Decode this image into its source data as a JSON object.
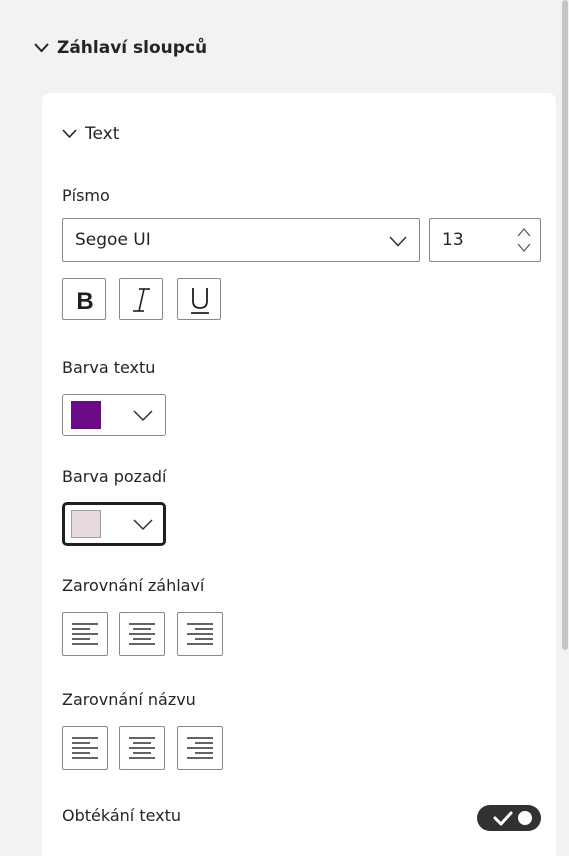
{
  "section": {
    "title": "Záhlaví sloupců"
  },
  "text_group": {
    "title": "Text",
    "font": {
      "label": "Písmo",
      "family": "Segoe UI",
      "size": "13"
    },
    "text_color": {
      "label": "Barva textu",
      "color": "#6b0a85"
    },
    "background_color": {
      "label": "Barva pozadí",
      "color": "#e7dadd"
    },
    "header_alignment": {
      "label": "Zarovnání záhlaví"
    },
    "title_alignment": {
      "label": "Zarovnání názvu"
    },
    "text_wrap": {
      "label": "Obtékání textu",
      "enabled": true
    }
  }
}
